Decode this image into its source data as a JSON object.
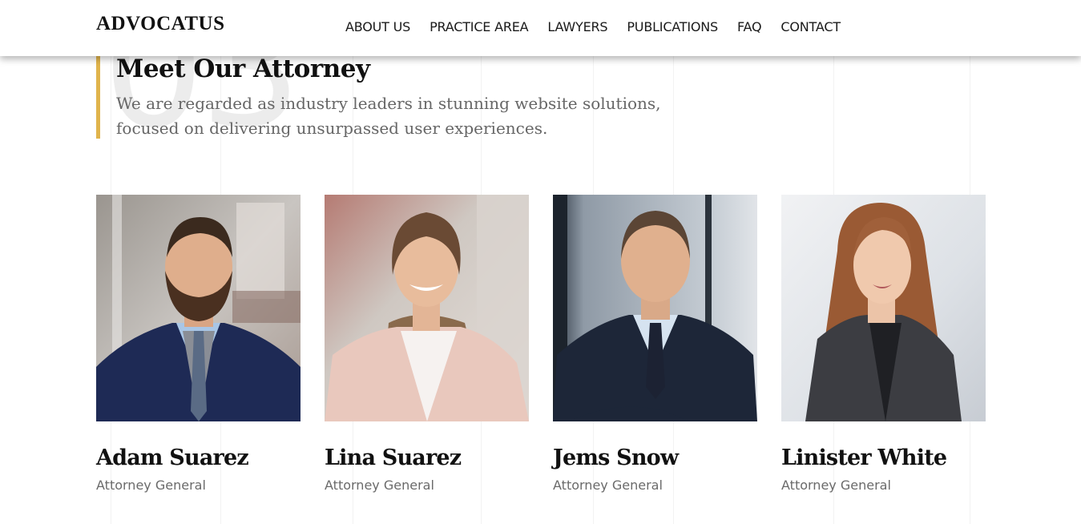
{
  "header": {
    "logo": "ADVOCATUS",
    "nav": [
      "ABOUT US",
      "PRACTICE AREA",
      "LAWYERS",
      "PUBLICATIONS",
      "FAQ",
      "CONTACT"
    ]
  },
  "section": {
    "number": "03",
    "title": "Meet Our Attorney",
    "description": "We are regarded as industry leaders in stunning website solutions, focused on delivering unsurpassed user experiences.",
    "accent_color": "#e0b44c"
  },
  "team": [
    {
      "name": "Adam Suarez",
      "role": "Attorney General",
      "photo": "portrait-man-bearded"
    },
    {
      "name": "Lina Suarez",
      "role": "Attorney General",
      "photo": "portrait-woman-smiling"
    },
    {
      "name": "Jems Snow",
      "role": "Attorney General",
      "photo": "portrait-man-suit"
    },
    {
      "name": "Linister White",
      "role": "Attorney General",
      "photo": "portrait-woman-long-hair"
    }
  ]
}
